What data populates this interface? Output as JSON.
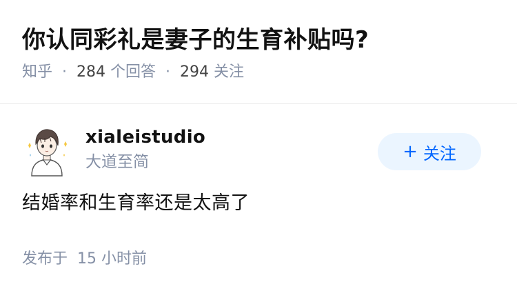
{
  "question": {
    "title": "你认同彩礼是妻子的生育补贴吗?",
    "source": "知乎",
    "separator": "·",
    "answer_count": "284",
    "answer_label": "个回答",
    "follower_count": "294",
    "follower_label": "关注"
  },
  "answer": {
    "author_name": "xialeistudio",
    "author_bio": "大道至简",
    "follow_plus": "+",
    "follow_label": "关注",
    "content": "结婚率和生育率还是太高了",
    "time_label": "发布于",
    "time_value": "15 小时前"
  },
  "colors": {
    "accent": "#0066ff",
    "follow_bg": "#ebf5ff",
    "meta_gray": "#8590a6",
    "text_dark": "#121212"
  }
}
